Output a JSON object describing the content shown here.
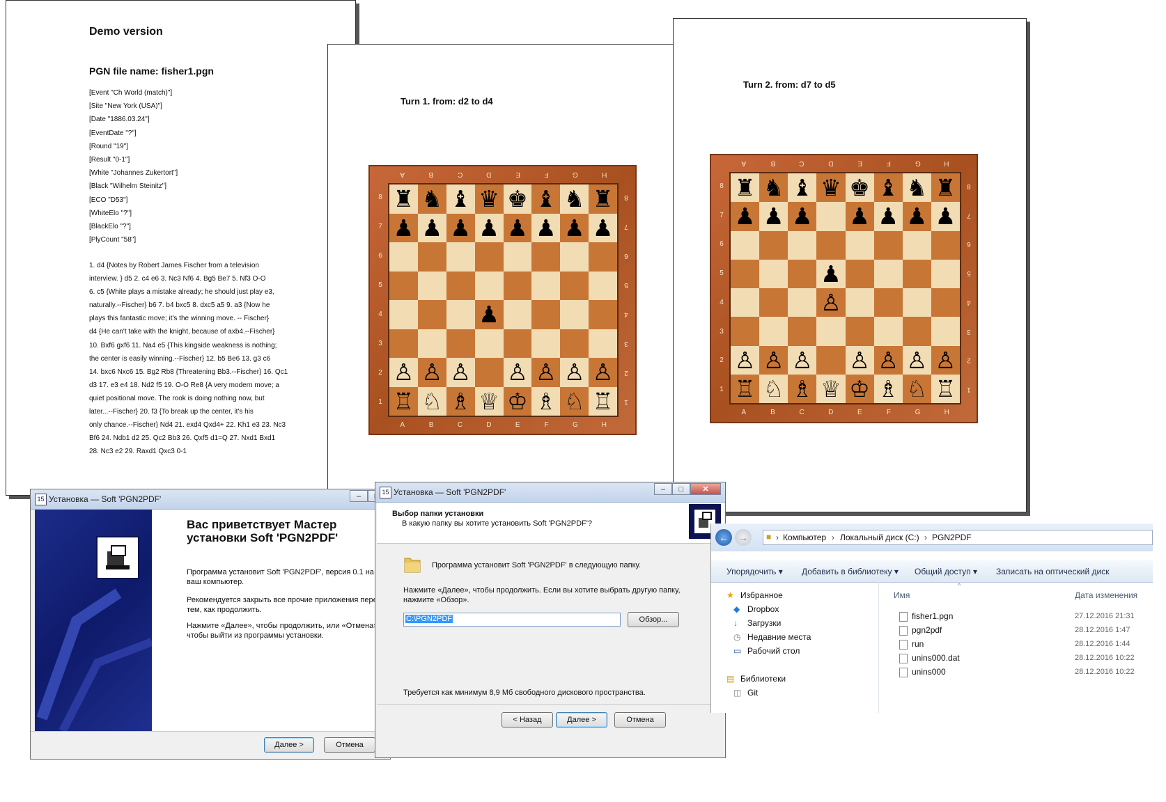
{
  "page1": {
    "demo_title": "Demo version",
    "pgn_title": "PGN file name: fisher1.pgn",
    "tags": [
      "[Event \"Ch World (match)\"]",
      "[Site \"New York (USA)\"]",
      "[Date \"1886.03.24\"]",
      "[EventDate \"?\"]",
      "[Round \"19\"]",
      "[Result \"0-1\"]",
      "[White \"Johannes Zukertort\"]",
      "[Black \"Wilhelm Steinitz\"]",
      "[ECO \"D53\"]",
      "[WhiteElo \"?\"]",
      "[BlackElo \"?\"]",
      "[PlyCount \"58\"]"
    ],
    "notes": [
      "1. d4 {Notes by Robert James Fischer from a television",
      "interview. } d5 2. c4 e6 3. Nc3 Nf6 4. Bg5 Be7 5. Nf3 O-O",
      "6. c5 {White plays a mistake already; he should just play e3,",
      "naturally.--Fischer} b6 7. b4 bxc5 8. dxc5 a5 9. a3 {Now he",
      "plays this fantastic move; it's the winning move. -- Fischer}",
      "d4 {He can't take with the knight, because of axb4.--Fischer}",
      "10. Bxf6 gxf6 11. Na4 e5 {This kingside weakness is nothing;",
      "the center is easily winning.--Fischer} 12. b5 Be6 13. g3 c6",
      "14. bxc6 Nxc6 15. Bg2 Rb8 {Threatening Bb3.--Fischer} 16. Qc1",
      "d3 17. e3 e4 18. Nd2 f5 19. O-O Re8 {A very modern move; a",
      "quiet positional move. The rook is doing nothing now, but",
      "later...--Fischer} 20. f3 {To break up the center, it's his",
      "only chance.--Fischer} Nd4 21. exd4 Qxd4+ 22. Kh1 e3 23. Nc3",
      "Bf6 24. Ndb1 d2 25. Qc2 Bb3 26. Qxf5 d1=Q 27. Nxd1 Bxd1",
      "28. Nc3 e2 29. Raxd1 Qxc3 0-1"
    ]
  },
  "page2": {
    "turn_title": "Turn 1. from: d2 to d4",
    "files": [
      "A",
      "B",
      "C",
      "D",
      "E",
      "F",
      "G",
      "H"
    ],
    "ranks": [
      "8",
      "7",
      "6",
      "5",
      "4",
      "3",
      "2",
      "1"
    ],
    "position": [
      "rnbqkbnr",
      "pppppppp",
      "........",
      "........",
      "...p....",
      "........",
      "ppp.pppp",
      "rnbqkbnr"
    ],
    "white_ranks_from": 6
  },
  "page3": {
    "turn_title": "Turn 2. from: d7 to d5",
    "files": [
      "A",
      "B",
      "C",
      "D",
      "E",
      "F",
      "G",
      "H"
    ],
    "ranks": [
      "8",
      "7",
      "6",
      "5",
      "4",
      "3",
      "2",
      "1"
    ],
    "position": [
      "rnbqkbnr",
      "ppp.pppp",
      "........",
      "...p....",
      "...p....",
      "........",
      "ppp.pppp",
      "rnbqkbnr"
    ],
    "white_ranks_from": 6,
    "white_pawn_d4": true
  },
  "setup1": {
    "title": "Установка — Soft 'PGN2PDF'",
    "heading": "Вас приветствует Мастер установки Soft 'PGN2PDF'",
    "p1": "Программа установит Soft 'PGN2PDF', версия 0.1 на ваш компьютер.",
    "p2": "Рекомендуется закрыть все прочие приложения перед тем, как продолжить.",
    "p3": "Нажмите «Далее», чтобы продолжить, или «Отмена», чтобы выйти из программы установки.",
    "next": "Далее >",
    "cancel": "Отмена"
  },
  "setup2": {
    "title": "Установка — Soft 'PGN2PDF'",
    "heading": "Выбор папки установки",
    "subheading": "В какую папку вы хотите установить Soft 'PGN2PDF'?",
    "info": "Программа установит Soft 'PGN2PDF' в следующую папку.",
    "hint": "Нажмите «Далее», чтобы продолжить. Если вы хотите выбрать другую папку, нажмите «Обзор».",
    "path_value": "C:\\PGN2PDF",
    "browse": "Обзор...",
    "space": "Требуется как минимум 8,9 Мб свободного дискового пространства.",
    "back": "< Назад",
    "next": "Далее >",
    "cancel": "Отмена"
  },
  "explorer": {
    "breadcrumb": [
      "Компьютер",
      "Локальный диск (C:)",
      "PGN2PDF"
    ],
    "toolbar": [
      "Упорядочить",
      "Добавить в библиотеку",
      "Общий доступ",
      "Записать на оптический диск"
    ],
    "nav": [
      {
        "icon": "star-icon",
        "label": "Избранное"
      },
      {
        "icon": "dropbox-icon",
        "label": "Dropbox"
      },
      {
        "icon": "downloads-icon",
        "label": "Загрузки"
      },
      {
        "icon": "recent-places-icon",
        "label": "Недавние места"
      },
      {
        "icon": "desktop-icon",
        "label": "Рабочий стол"
      },
      {
        "icon": "library-icon",
        "label": "Библиотеки"
      },
      {
        "icon": "git-icon",
        "label": "Git"
      }
    ],
    "col_name": "Имя",
    "col_date": "Дата изменения",
    "files": [
      {
        "name": "fisher1.pgn",
        "date": "27.12.2016 21:31"
      },
      {
        "name": "pgn2pdf",
        "date": "28.12.2016 1:47"
      },
      {
        "name": "run",
        "date": "28.12.2016 1:44"
      },
      {
        "name": "unins000.dat",
        "date": "28.12.2016 10:22"
      },
      {
        "name": "unins000",
        "date": "28.12.2016 10:22"
      }
    ]
  }
}
